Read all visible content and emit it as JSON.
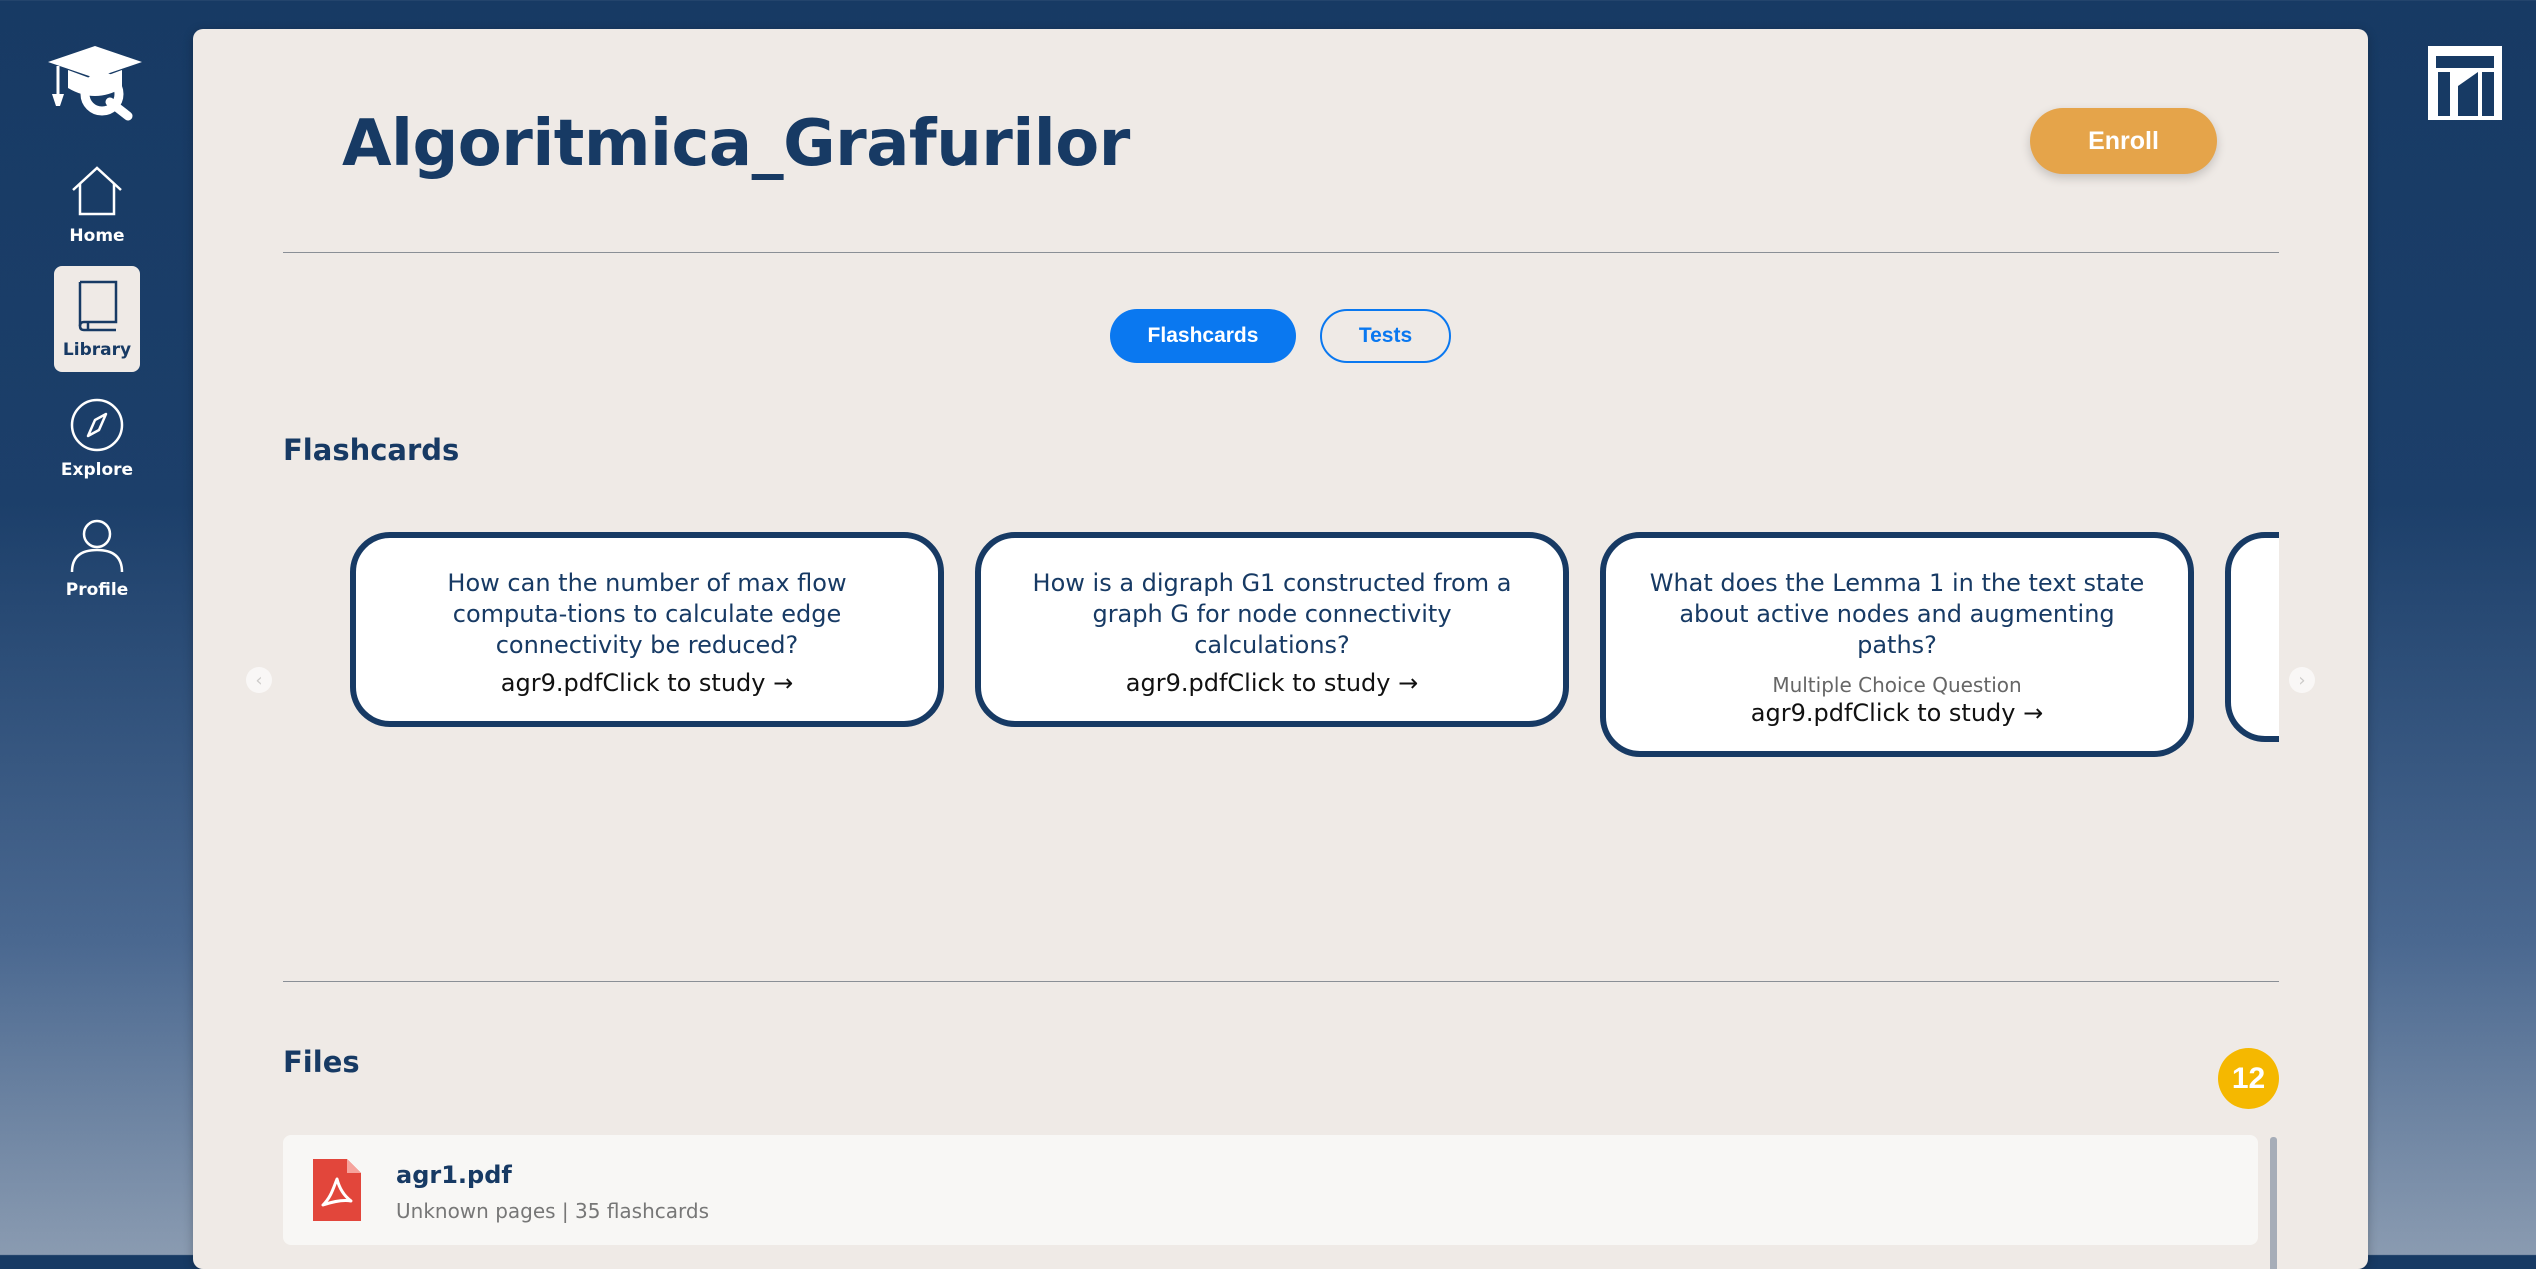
{
  "nav": {
    "items": [
      {
        "label": "Home",
        "icon": "home-icon"
      },
      {
        "label": "Library",
        "icon": "book-icon",
        "active": true
      },
      {
        "label": "Explore",
        "icon": "compass-icon"
      },
      {
        "label": "Profile",
        "icon": "user-icon"
      }
    ]
  },
  "course": {
    "title": "Algoritmica_Grafurilor",
    "enroll_label": "Enroll"
  },
  "tabs": {
    "flashcards": "Flashcards",
    "tests": "Tests"
  },
  "flashcards": {
    "heading": "Flashcards",
    "cards": [
      {
        "question": "How can the number of max flow computa-tions to calculate edge connectivity be reduced?",
        "type": "",
        "meta": "agr9.pdfClick to study →"
      },
      {
        "question": "How is a digraph G1 constructed from a graph G for node connectivity calculations?",
        "type": "",
        "meta": "agr9.pdfClick to study →"
      },
      {
        "question": "What does the Lemma 1 in the text state about active nodes and augmenting paths?",
        "type": "Multiple Choice Question",
        "meta": "agr9.pdfClick to study →"
      }
    ]
  },
  "files": {
    "heading": "Files",
    "count": "12",
    "items": [
      {
        "name": "agr1.pdf",
        "meta": "Unknown pages | 35 flashcards",
        "icon": "pdf-icon"
      }
    ]
  },
  "colors": {
    "navy": "#173a64",
    "accent_orange": "#e5a44a",
    "primary_blue": "#0a78f0",
    "badge_yellow": "#f5b800",
    "pdf_red": "#e2463b",
    "panel_bg": "#efeae6"
  }
}
